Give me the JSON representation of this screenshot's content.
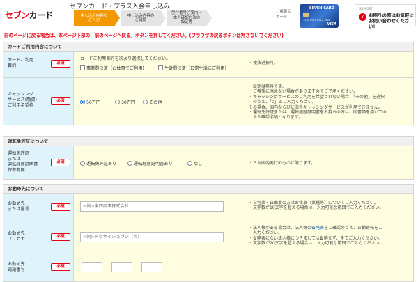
{
  "header": {
    "logo_text_red": "セブン",
    "logo_text_dark": "カード",
    "title": "セブンカード・プラス入会申し込み",
    "steps": [
      {
        "line1": "申し込み内容の",
        "line2": "ご入力",
        "line3": "",
        "active": true
      },
      {
        "line1": "申し込み内容の",
        "line2": "ご確認",
        "line3": "",
        "active": false
      },
      {
        "line1": "受付番号ご案内・",
        "line2": "本人確認方法の",
        "line3": "設定等",
        "active": false
      }
    ],
    "card_label_line1": "ご希望の",
    "card_label_line2": "カード",
    "card_brand": "SEVEN CARD",
    "card_number": "1234 5678 9012 3456",
    "card_network": "VISA",
    "support_small": "SUPPORT",
    "support_line1": "お困りの際はお気軽に",
    "support_line2": "お問い合わせください!"
  },
  "notice": "前のページに戻る場合は、本ページ下部の「前のページへ戻る」ボタンを押してください。(ブラウザの戻るボタンは押さないでください)",
  "required_label": "必須",
  "card_section": {
    "title": "カードご利用内容について",
    "purpose": {
      "label1": "カードご利用",
      "label2": "目的",
      "instruction": "カードご利用目的を次より選択してください。",
      "options": [
        "事業費決済（お仕事でご利用）",
        "生計費決済（日常生活にご利用）"
      ],
      "note": "・複数選択可。"
    },
    "cashing": {
      "label1": "キャッシング",
      "label2": "サービス(融資)",
      "label3": "ご利用希望枠",
      "options": [
        "50万円",
        "30万円",
        "その他"
      ],
      "selected": "50万円",
      "notes": [
        "・設定は無料です。",
        "・ご希望に添えない場合がありますのでご了承ください。",
        "・キャッシングサービスのご利用を希望されない場合、「その他」を選択",
        "　のうえ、「0」とご入力ください。",
        "その場合、国内ならびに海外キャッシングサービスが利用できません。",
        "・運転免許証または、運転経歴証明書をお持ちの方は、同書類を用いての",
        "　本人確認必須となります。"
      ]
    }
  },
  "license_section": {
    "title": "運転免許証について",
    "label1": "運転免許証",
    "label2": "または",
    "label3": "運転経歴証明書",
    "label4": "保有有無",
    "options": [
      "運転免許証あり",
      "運転経歴証明書あり",
      "なし"
    ],
    "note": "・日本国内発行のものに限ります。"
  },
  "work_section": {
    "title": "お勤め先について",
    "name": {
      "label1": "お勤め先",
      "label2": "または屋号",
      "placeholder": "<例>東西商事株式会社",
      "notes": [
        "・自営業・自由業の方はお仕事（業種等）についてご入力ください。",
        "・文字数が18文字を超える場合は、入力可能な範囲でご入力ください。"
      ]
    },
    "kana": {
      "label1": "お勤め先",
      "label2": "フリガナ",
      "placeholder": "<例>トウザイショウジ（カ）",
      "note1_before": "・法人格がある場合は、法人格の",
      "note1_link": "省略表",
      "note1_after": "をご確認のうえ、お勤め先をご",
      "notes_rest": [
        "　入力ください。",
        "・省略表にない法人格につきましては省略せず、全てご入力ください。",
        "・文字数が20文字を超える場合は、入力可能な範囲でご入力ください。"
      ]
    },
    "tel": {
      "label1": "お勤め先",
      "label2": "電話番号",
      "dash": "－"
    }
  },
  "colors": {
    "accent": "#f39800",
    "brand_red": "#e60012",
    "label_bg": "#dff3fb",
    "field_bg": "#fffde0"
  }
}
